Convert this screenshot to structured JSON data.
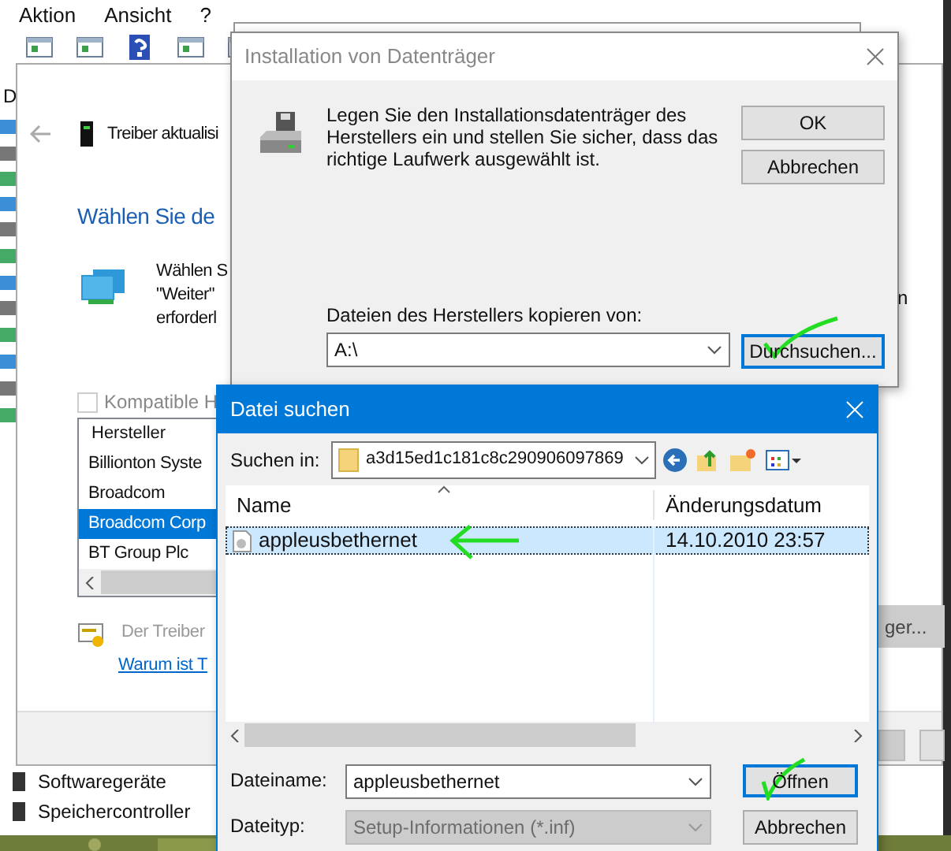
{
  "device_manager": {
    "menu": [
      "Aktion",
      "Ansicht",
      "?"
    ],
    "tree_header": "D",
    "tree_items": [
      "Softwaregeräte",
      "Speichercontroller"
    ]
  },
  "update_wizard": {
    "title": "Treiber aktualisi",
    "heading": "Wählen Sie de",
    "description": [
      "Wählen S",
      "\"Weiter\"",
      "erforderl"
    ],
    "right_fragment": "n",
    "compatible_checkbox": {
      "label": "Kompatible H",
      "checked": false
    },
    "manufacturers": {
      "header": "Hersteller",
      "items": [
        {
          "label": "Billionton Syste",
          "selected": false
        },
        {
          "label": "Broadcom",
          "selected": false
        },
        {
          "label": "Broadcom Corp",
          "selected": true
        },
        {
          "label": "BT Group Plc",
          "selected": false
        }
      ]
    },
    "note": "Der Treiber",
    "link": "Warum ist T",
    "disk_button": "ger..."
  },
  "install_disk_dialog": {
    "title": "Installation von Datenträger",
    "message": "Legen Sie den Installationsdatenträger des Herstellers ein und stellen Sie sicher, dass das richtige Laufwerk ausgewählt ist.",
    "buttons": [
      {
        "label": "OK",
        "focused": false
      },
      {
        "label": "Abbrechen",
        "focused": false
      }
    ],
    "copy_from_label": "Dateien des Herstellers kopieren von:",
    "copy_from_value": "A:\\",
    "browse_button": {
      "label": "Durchsuchen...",
      "focused": true
    }
  },
  "file_dialog": {
    "title": "Datei suchen",
    "look_in_label": "Suchen in:",
    "look_in_value": "a3d15ed1c181c8c290906097869",
    "columns": [
      "Name",
      "Änderungsdatum"
    ],
    "rows": [
      {
        "name": "appleusbethernet",
        "modified": "14.10.2010 23:57",
        "selected": true
      }
    ],
    "filename_label": "Dateiname:",
    "filename_value": "appleusbethernet",
    "filetype_label": "Dateityp:",
    "filetype": {
      "value": "Setup-Informationen (*.inf)",
      "disabled": true
    },
    "buttons": [
      {
        "label": "Öffnen",
        "focused": true
      },
      {
        "label": "Abbrechen",
        "focused": false
      }
    ]
  }
}
